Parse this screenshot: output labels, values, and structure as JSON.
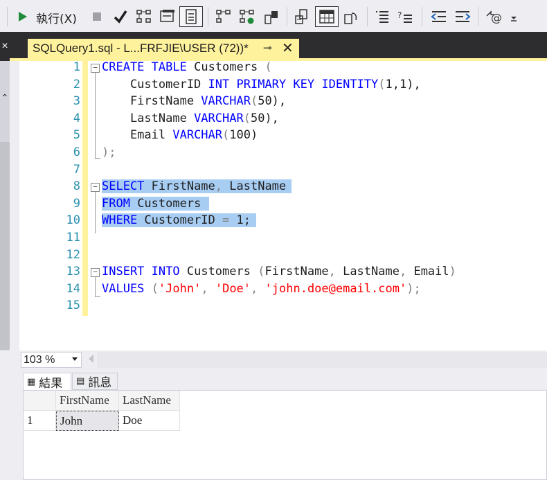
{
  "toolbar": {
    "execute_label": "執行(X)",
    "icons": [
      "run-icon",
      "stop-icon",
      "parse-check-icon",
      "display-plan-icon",
      "query-options-icon",
      "results-to-text-icon",
      "results-to-grid-icon",
      "results-to-file-icon",
      "include-plan-icon",
      "include-stats-icon",
      "live-stats-icon",
      "comment-icon",
      "uncomment-icon",
      "outdent-icon",
      "indent-icon",
      "specify-values-icon"
    ]
  },
  "left_panel": {
    "close_glyph": "×",
    "caret_glyph": "⌃"
  },
  "tab": {
    "title": "SQLQuery1.sql - L...FRFJIE\\USER (72))*",
    "pin_glyph": "⊸",
    "close_glyph": "✕"
  },
  "editor": {
    "line_numbers": [
      "1",
      "2",
      "3",
      "4",
      "5",
      "6",
      "7",
      "8",
      "9",
      "10",
      "11",
      "12",
      "13",
      "14",
      "15"
    ],
    "lines": [
      "CREATE TABLE Customers (",
      "    CustomerID INT PRIMARY KEY IDENTITY(1,1),",
      "    FirstName VARCHAR(50),",
      "    LastName VARCHAR(50),",
      "    Email VARCHAR(100)",
      ");",
      "",
      "SELECT FirstName, LastName",
      "FROM Customers",
      "WHERE CustomerID = 1;",
      "",
      "",
      "INSERT INTO Customers (FirstName, LastName, Email)",
      "VALUES ('John', 'Doe', 'john.doe@email.com');",
      ""
    ],
    "selected_lines": [
      8,
      9,
      10
    ]
  },
  "zoom": {
    "value": "103 %"
  },
  "results_tabs": [
    {
      "label": "結果",
      "icon": "grid-icon",
      "active": true
    },
    {
      "label": "訊息",
      "icon": "messages-icon",
      "active": false
    }
  ],
  "results_grid": {
    "columns": [
      "FirstName",
      "LastName"
    ],
    "rows": [
      {
        "row_number": "1",
        "cells": [
          "John",
          "Doe"
        ]
      }
    ]
  }
}
